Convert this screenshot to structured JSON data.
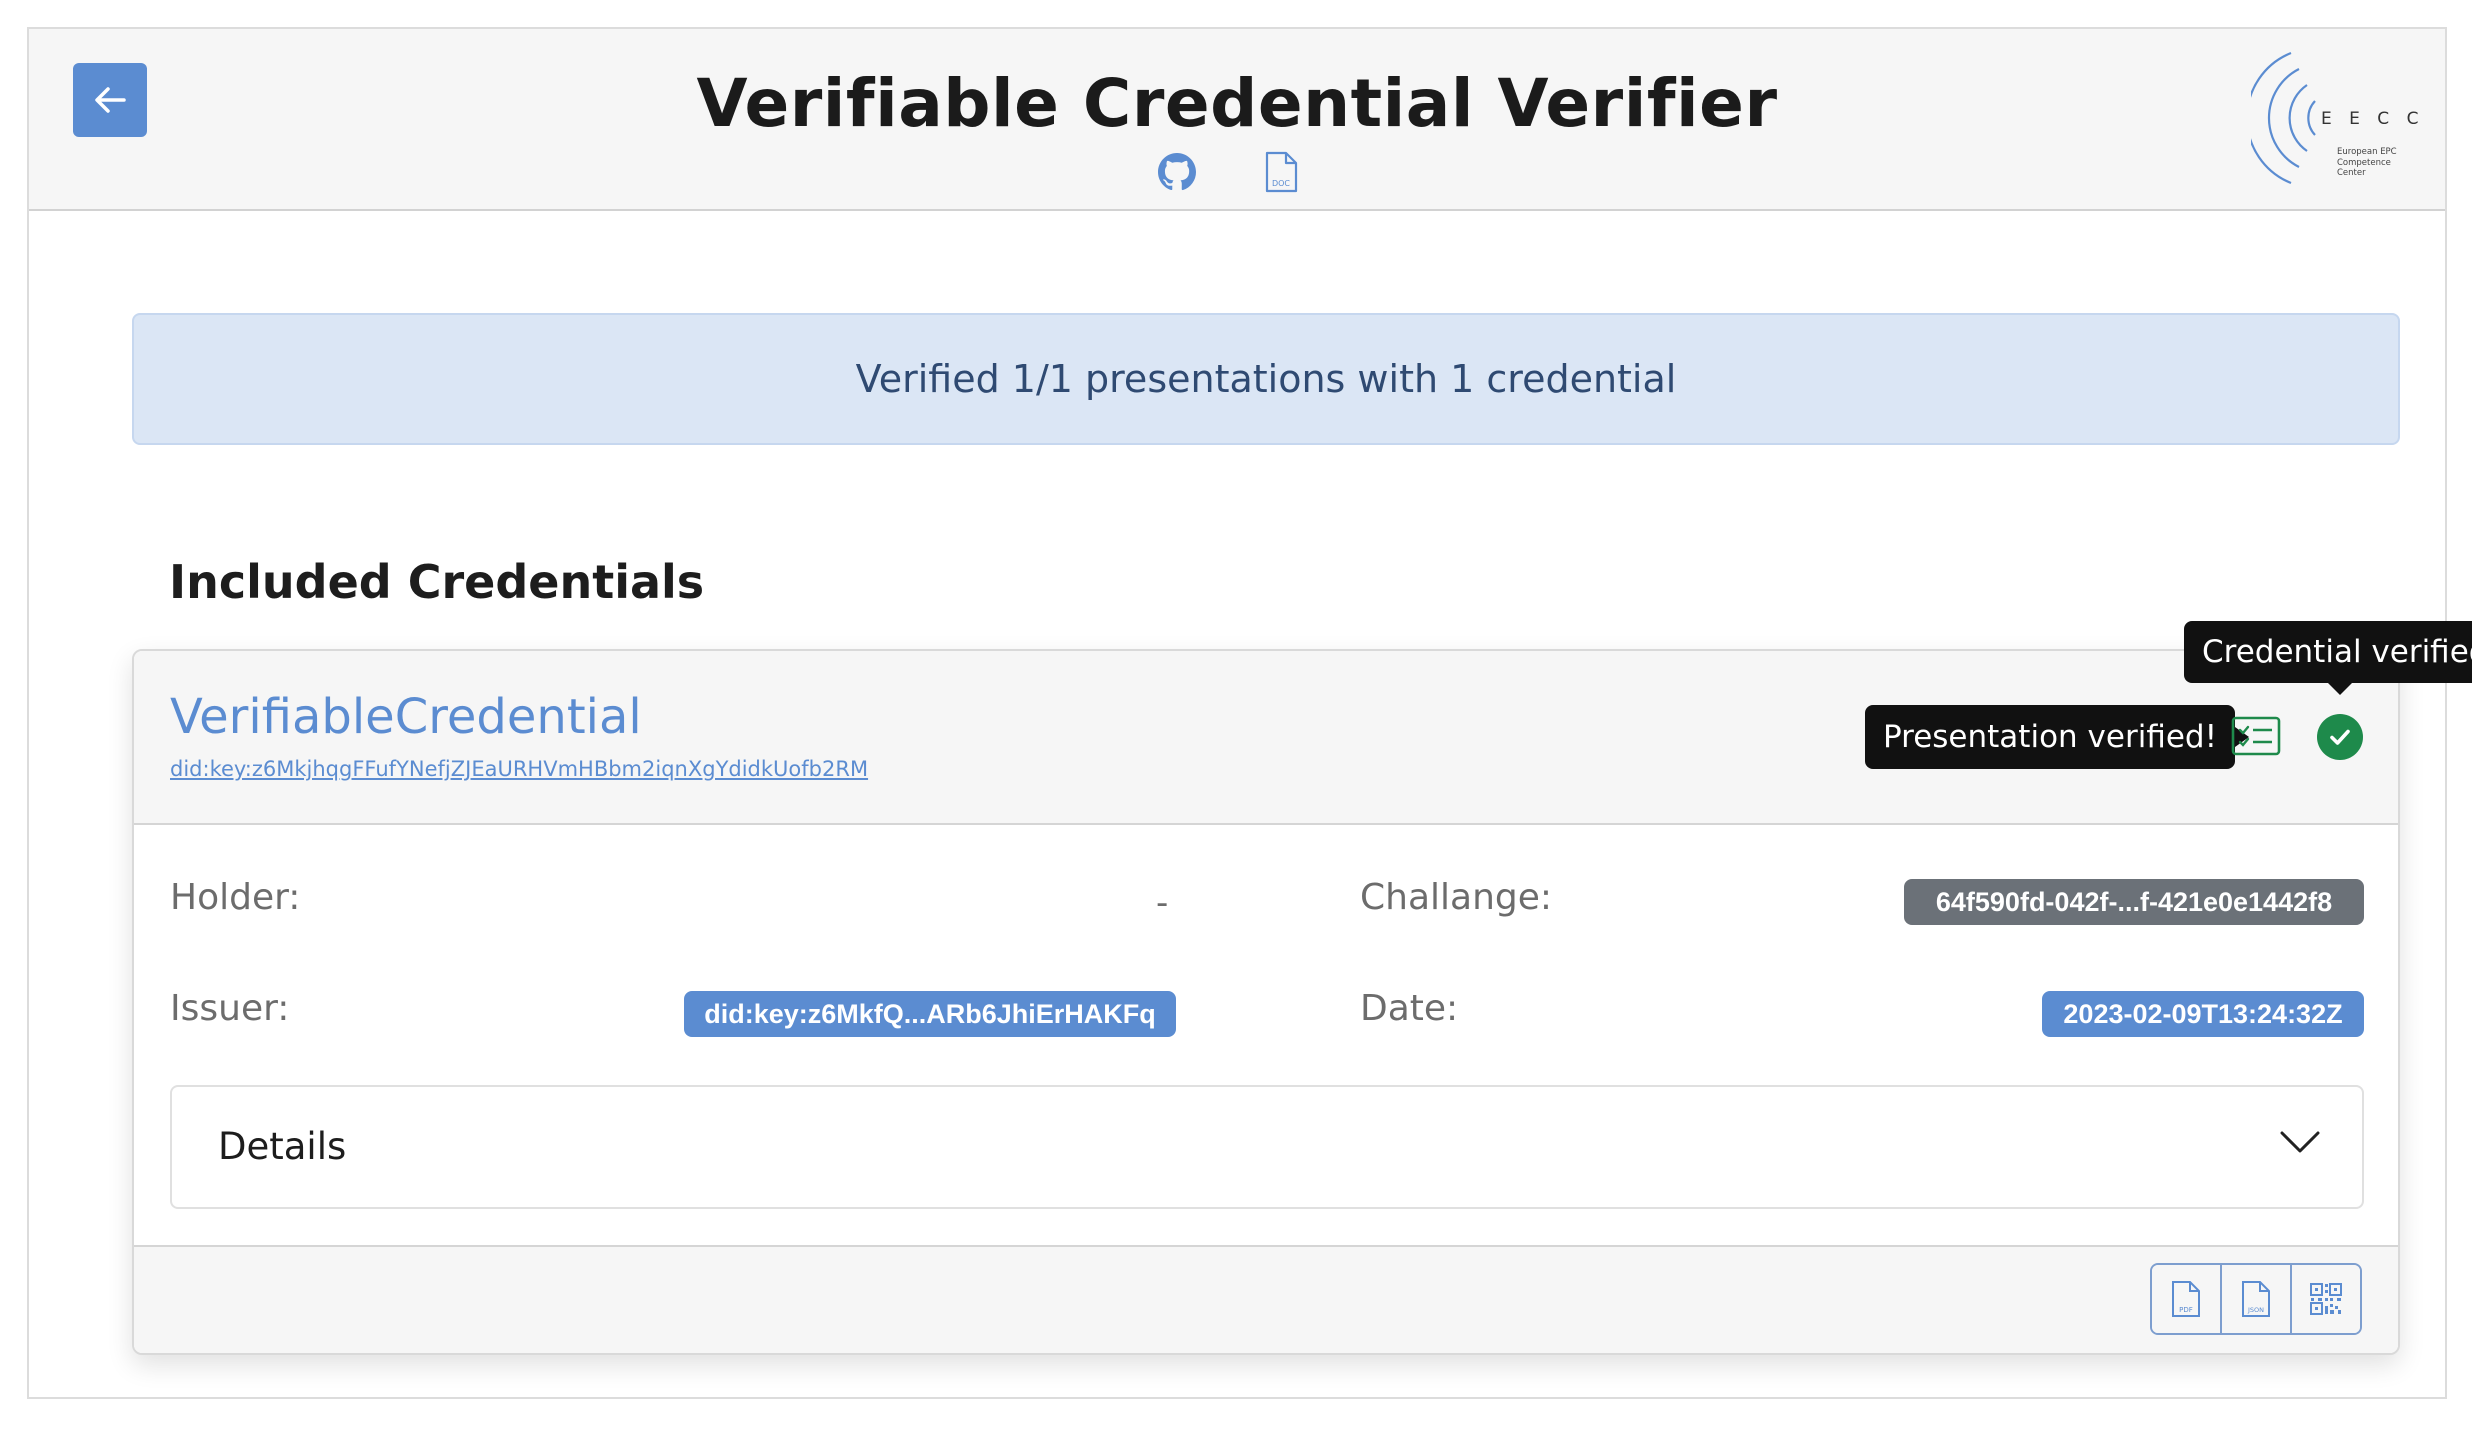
{
  "header": {
    "title": "Verifiable Credential Verifier",
    "doc_icon_label": "DOC",
    "logo": {
      "title": "E E C C",
      "subtitle": "European EPC Competence Center"
    }
  },
  "alert": {
    "message": "Verified 1/1 presentations with 1 credential"
  },
  "section": {
    "title": "Included Credentials"
  },
  "credential": {
    "title": "VerifiableCredential",
    "did": "did:key:z6MkjhqgFFufYNefjZJEaURHVmHBbm2iqnXgYdidkUofb2RM",
    "tooltips": {
      "presentation": "Presentation verified!",
      "credential": "Credential verified!"
    },
    "fields": {
      "holder_label": "Holder:",
      "holder_value": "-",
      "issuer_label": "Issuer:",
      "issuer_value": "did:key:z6MkfQ...ARb6JhiErHAKFq",
      "challenge_label": "Challange:",
      "challenge_value": "64f590fd-042f-...f-421e0e1442f8",
      "date_label": "Date:",
      "date_value": "2023-02-09T13:24:32Z"
    },
    "details_label": "Details",
    "footer_buttons": {
      "pdf": "PDF",
      "json": "JSON"
    }
  },
  "colors": {
    "accent": "#5b8cd1",
    "success": "#1e8a4b",
    "alert_bg": "#dbe6f5",
    "badge_gray": "#6b7178"
  }
}
